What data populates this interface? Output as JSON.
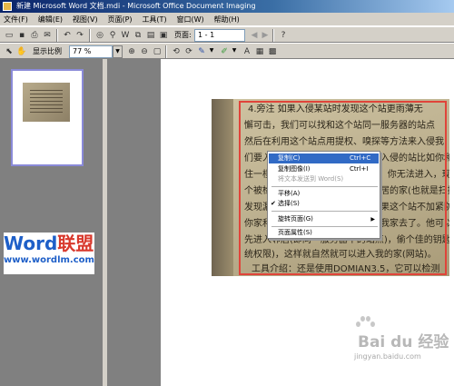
{
  "titlebar": {
    "title": "新建 Microsoft Word 文档.mdi - Microsoft Office Document Imaging"
  },
  "menubar": {
    "items": [
      "文件(F)",
      "编辑(E)",
      "视图(V)",
      "页面(P)",
      "工具(T)",
      "窗口(W)",
      "帮助(H)"
    ]
  },
  "toolbar": {
    "page_label": "页面:",
    "page_value": "1 - 1",
    "zoom_label": "显示比例",
    "zoom_value": "77 %"
  },
  "thumbnail": {
    "page_number": "1"
  },
  "brand": {
    "logo_part1": "Word",
    "logo_part2": "联盟",
    "site": "www.wordlm.com"
  },
  "scan_lines": [
    "4.旁注 如果入侵某站时发现这个站更雨薄无",
    "懈可击，我们可以找和这个站同一服务器的站点",
    "然后在利用这个站点用提权、嗅探等方法来入侵我",
    "们要入侵的目标站点。例如，你想入侵的站比如你和我同",
    "住一楼，我的家门口(主站)很坚固，你无法进入，现在在",
    "个被检测，你就可以先进入我的邻居的家(也就是扫描)",
    "发现漏洞，从他家进入到我家，如果这个站不加紧防",
    "你家和我的家对门，你通过他进入我家去了。他可以",
    "先进入邻居(即同一服务器中的站点)，偷个佳的钥匙(系",
    "统权限)，这样就自然就可以进入我的家(网站)。",
    "工具介绍：还是使用DOMIAN3.5，它可以检测"
  ],
  "context_menu": {
    "items": [
      {
        "label": "复制(C)",
        "shortcut": "Ctrl+C",
        "state": "selected"
      },
      {
        "label": "复制图像(I)",
        "shortcut": "Ctrl+I",
        "state": "normal"
      },
      {
        "label": "将文本发送到 Word(S)",
        "shortcut": "",
        "state": "disabled"
      },
      {
        "label": "平移(A)",
        "shortcut": "",
        "state": "normal"
      },
      {
        "label": "选择(S)",
        "shortcut": "",
        "state": "checked"
      },
      {
        "label": "旋转页面(G)",
        "shortcut": "",
        "state": "submenu"
      },
      {
        "label": "页面属性(S)",
        "shortcut": "",
        "state": "normal"
      }
    ]
  },
  "watermark": {
    "text": "Bai du 经验",
    "sub": "jingyan.baidu.com"
  },
  "colors": {
    "titlebar": "#0a246a",
    "selection": "#316ac5",
    "annotation_border": "#e0443a"
  }
}
